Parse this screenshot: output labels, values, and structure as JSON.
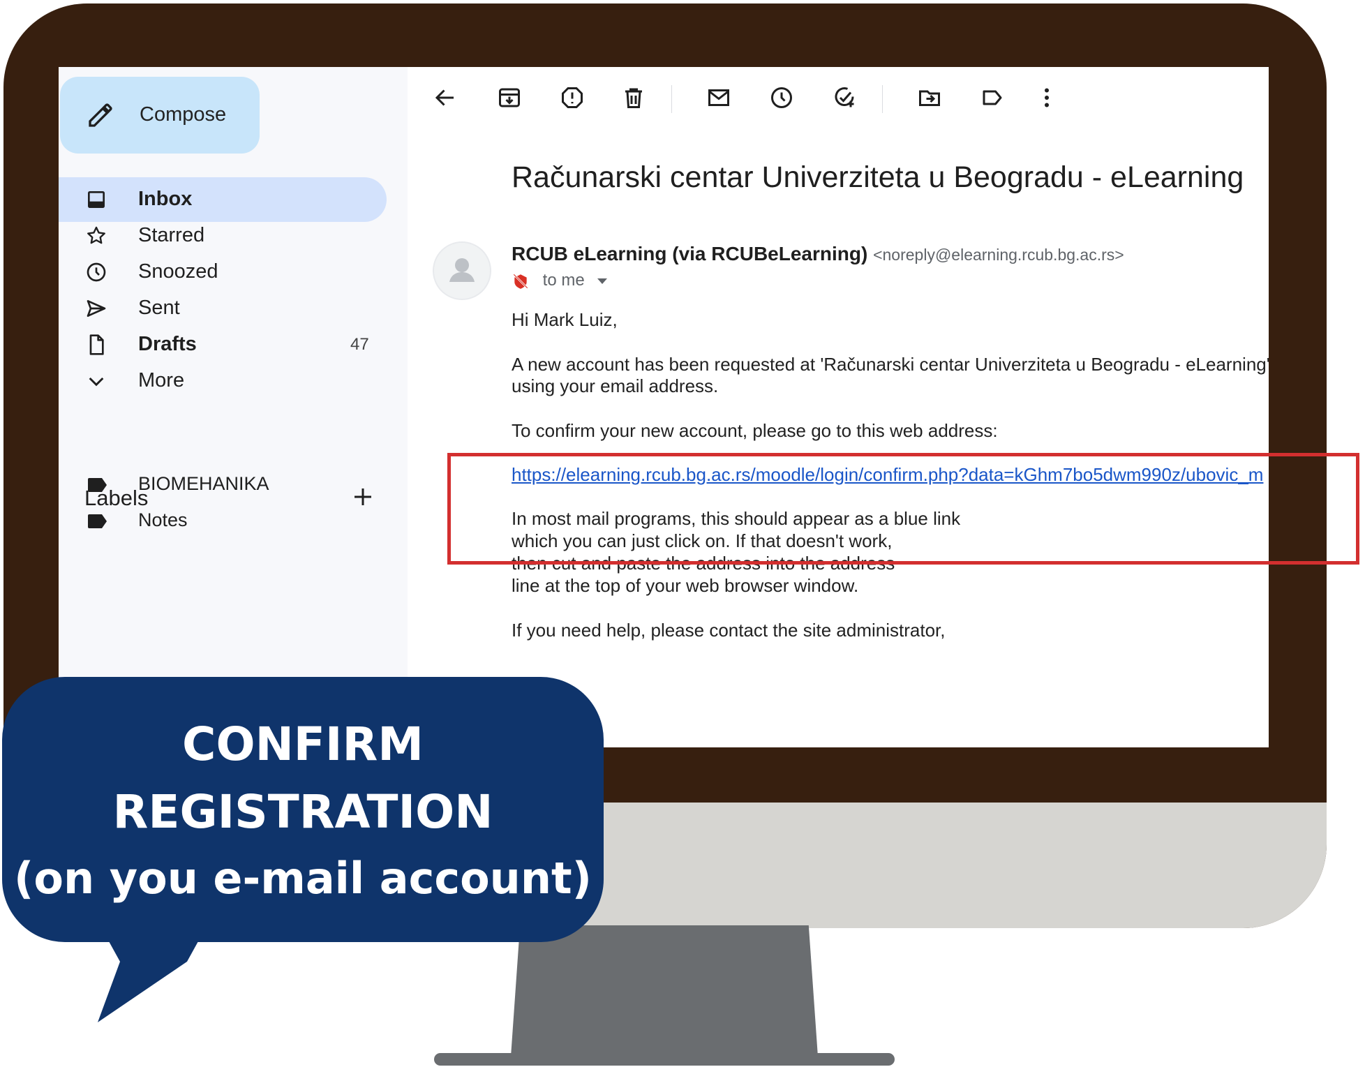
{
  "sidebar": {
    "compose_label": "Compose",
    "items": [
      {
        "label": "Inbox"
      },
      {
        "label": "Starred"
      },
      {
        "label": "Snoozed"
      },
      {
        "label": "Sent"
      },
      {
        "label": "Drafts",
        "count": "47"
      },
      {
        "label": "More"
      }
    ],
    "labels_title": "Labels",
    "labels": [
      {
        "label": "BIOMEHANIKA"
      },
      {
        "label": "Notes"
      }
    ]
  },
  "toolbar": {
    "icons": [
      "back-icon",
      "archive-icon",
      "report-spam-icon",
      "delete-icon",
      "mark-unread-icon",
      "snooze-icon",
      "add-task-icon",
      "move-to-icon",
      "label-icon",
      "more-vert-icon"
    ]
  },
  "email": {
    "subject": "Računarski centar Univerziteta u Beogradu - eLearning",
    "sender_name": "RCUB eLearning (via RCUBeLearning)",
    "sender_email": "<noreply@elearning.rcub.bg.ac.rs>",
    "to": "to me",
    "body": {
      "greeting": "Hi Mark Luiz,",
      "line1": "A new account has been requested at 'Računarski centar Univerziteta u Beogradu - eLearning'",
      "line2": "using your email address.",
      "line3": "To confirm your new account, please go to this web address:",
      "link": "https://elearning.rcub.bg.ac.rs/moodle/login/confirm.php?data=kGhm7bo5dwm990z/ubovic_m",
      "line4": "In most mail programs, this should appear as a blue link",
      "line5": "which you can just click on. If that doesn't work,",
      "line6": "then cut and paste the address into the address",
      "line7": "line at the top of your web browser window.",
      "line8": "If you need help, please contact the site administrator,"
    }
  },
  "callout": {
    "line1": "CONFIRM",
    "line2": "REGISTRATION",
    "line3": "(on you e-mail account)"
  },
  "colors": {
    "monitor_frame": "#371f0f",
    "bubble": "#0f346b",
    "highlight": "#d32f2f",
    "compose_bg": "#c8e5fa",
    "inbox_active": "#d3e2fc"
  }
}
